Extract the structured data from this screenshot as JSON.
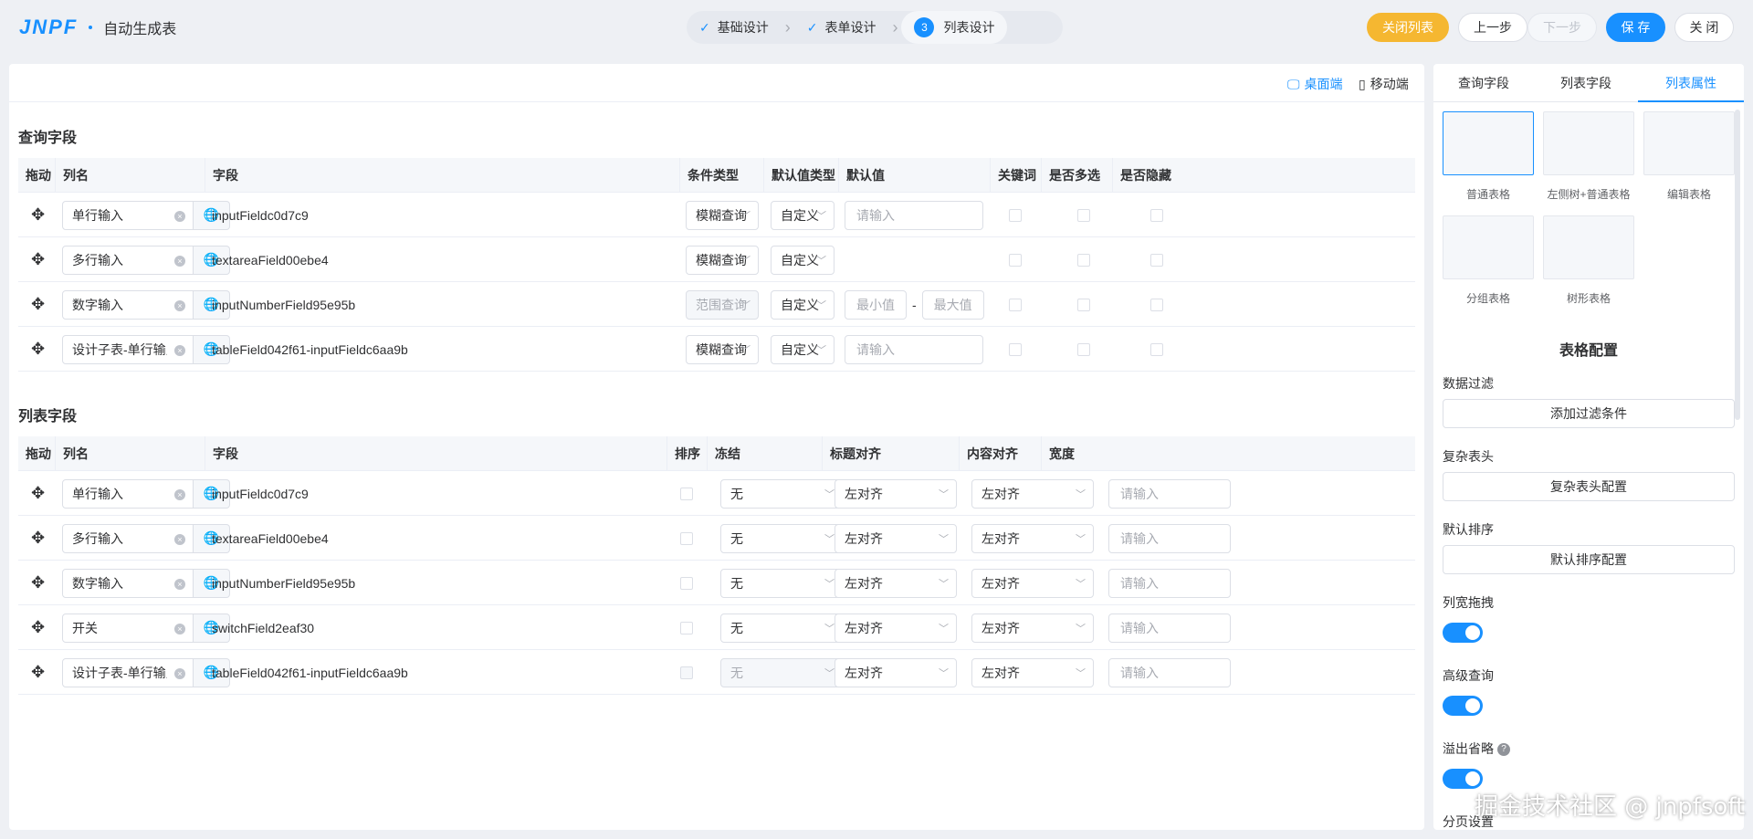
{
  "app": {
    "logo": "JNPF",
    "title": "自动生成表"
  },
  "steps": [
    {
      "label": "基础设计",
      "done": true
    },
    {
      "label": "表单设计",
      "done": true
    },
    {
      "label": "列表设计",
      "num": "3",
      "active": true
    }
  ],
  "actions": {
    "close_list": "关闭列表",
    "prev": "上一步",
    "next": "下一步",
    "save": "保 存",
    "close": "关 闭"
  },
  "devices": {
    "desktop": "桌面端",
    "mobile": "移动端"
  },
  "query": {
    "title": "查询字段",
    "headers": [
      "拖动",
      "列名",
      "字段",
      "条件类型",
      "默认值类型",
      "默认值",
      "关键词",
      "是否多选",
      "是否隐藏"
    ],
    "rows": [
      {
        "name": "单行输入",
        "field": "inputFieldc0d7c9",
        "cond": "模糊查询",
        "cond_disabled": false,
        "deftype": "自定义",
        "input": "请输入"
      },
      {
        "name": "多行输入",
        "field": "textareaField00ebe4",
        "cond": "模糊查询",
        "cond_disabled": false,
        "deftype": "自定义"
      },
      {
        "name": "数字输入",
        "field": "inputNumberField95e95b",
        "cond": "范围查询",
        "cond_disabled": true,
        "deftype": "自定义",
        "min": "最小值",
        "sep": "-",
        "max": "最大值"
      },
      {
        "name": "设计子表-单行输入",
        "field": "tableField042f61-inputFieldc6aa9b",
        "cond": "模糊查询",
        "cond_disabled": false,
        "deftype": "自定义",
        "input": "请输入"
      }
    ]
  },
  "list": {
    "title": "列表字段",
    "headers": [
      "拖动",
      "列名",
      "字段",
      "排序",
      "冻结",
      "标题对齐",
      "内容对齐",
      "宽度"
    ],
    "rows": [
      {
        "name": "单行输入",
        "field": "inputFieldc0d7c9",
        "freeze": "无",
        "freeze_disabled": false,
        "title_align": "左对齐",
        "content_align": "左对齐",
        "width": "请输入"
      },
      {
        "name": "多行输入",
        "field": "textareaField00ebe4",
        "freeze": "无",
        "freeze_disabled": false,
        "title_align": "左对齐",
        "content_align": "左对齐",
        "width": "请输入"
      },
      {
        "name": "数字输入",
        "field": "inputNumberField95e95b",
        "freeze": "无",
        "freeze_disabled": false,
        "title_align": "左对齐",
        "content_align": "左对齐",
        "width": "请输入"
      },
      {
        "name": "开关",
        "field": "switchField2eaf30",
        "freeze": "无",
        "freeze_disabled": false,
        "title_align": "左对齐",
        "content_align": "左对齐",
        "width": "请输入"
      },
      {
        "name": "设计子表-单行输入",
        "field": "tableField042f61-inputFieldc6aa9b",
        "freeze": "无",
        "freeze_disabled": true,
        "title_align": "左对齐",
        "content_align": "左对齐",
        "width": "请输入"
      }
    ]
  },
  "side": {
    "tabs": [
      "查询字段",
      "列表字段",
      "列表属性"
    ],
    "layouts": [
      "普通表格",
      "左侧树+普通表格",
      "编辑表格",
      "分组表格",
      "树形表格"
    ],
    "config_title": "表格配置",
    "data_filter": {
      "label": "数据过滤",
      "button": "添加过滤条件"
    },
    "complex_header": {
      "label": "复杂表头",
      "button": "复杂表头配置"
    },
    "default_sort": {
      "label": "默认排序",
      "button": "默认排序配置"
    },
    "col_drag": "列宽拖拽",
    "adv_query": "高级查询",
    "overflow": "溢出省略",
    "paging": "分页设置"
  },
  "watermark": "掘金技术社区 @ jnpfsoft",
  "colors": {
    "primary": "#1890ff",
    "warning": "#f5b731"
  }
}
